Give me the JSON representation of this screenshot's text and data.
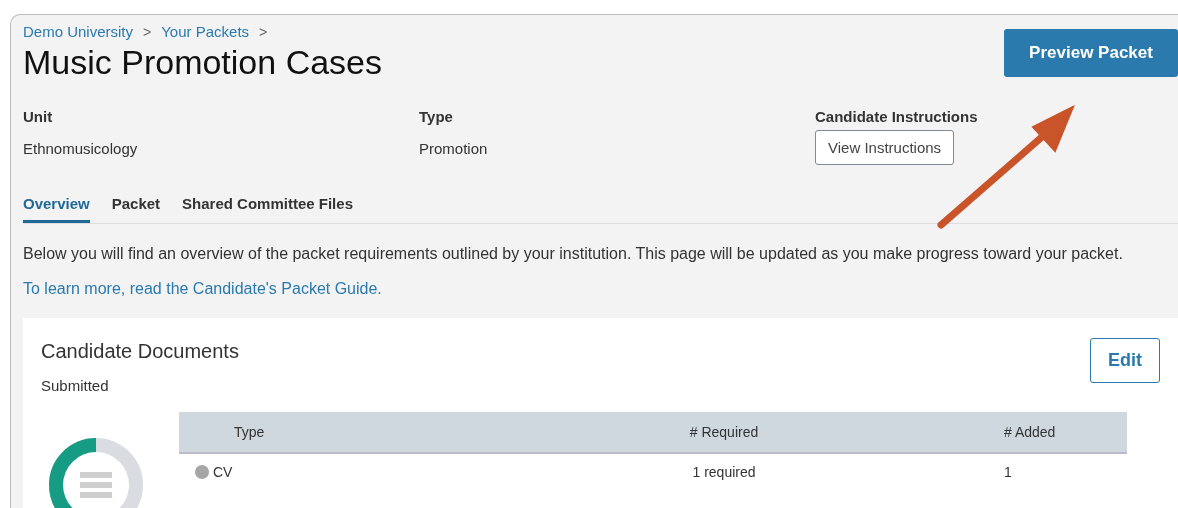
{
  "breadcrumbs": [
    {
      "label": "Demo University"
    },
    {
      "label": "Your Packets"
    }
  ],
  "breadcrumb_separator": ">",
  "title": "Music Promotion Cases",
  "primary_button": "Preview Packet",
  "details": [
    {
      "label": "Unit",
      "kind": "text",
      "value": "Ethnomusicology"
    },
    {
      "label": "Type",
      "kind": "text",
      "value": "Promotion"
    },
    {
      "label": "Candidate Instructions",
      "kind": "button",
      "value": "View Instructions"
    }
  ],
  "tabs": [
    {
      "label": "Overview",
      "selected": true
    },
    {
      "label": "Packet",
      "selected": false
    },
    {
      "label": "Shared Committee Files",
      "selected": false
    }
  ],
  "intro": {
    "text": "Below you will find an overview of the packet requirements outlined by your institution. This page will be updated as you make progress toward your packet.",
    "link": "To learn more, read the Candidate's Packet Guide."
  },
  "card": {
    "title": "Candidate Documents",
    "status": "Submitted",
    "edit_button": "Edit",
    "table": {
      "columns": [
        "Type",
        "# Required",
        "# Added"
      ],
      "rows": [
        {
          "cells": [
            "CV",
            "1 required",
            "1"
          ],
          "color": "#a6a6a6"
        }
      ]
    }
  }
}
